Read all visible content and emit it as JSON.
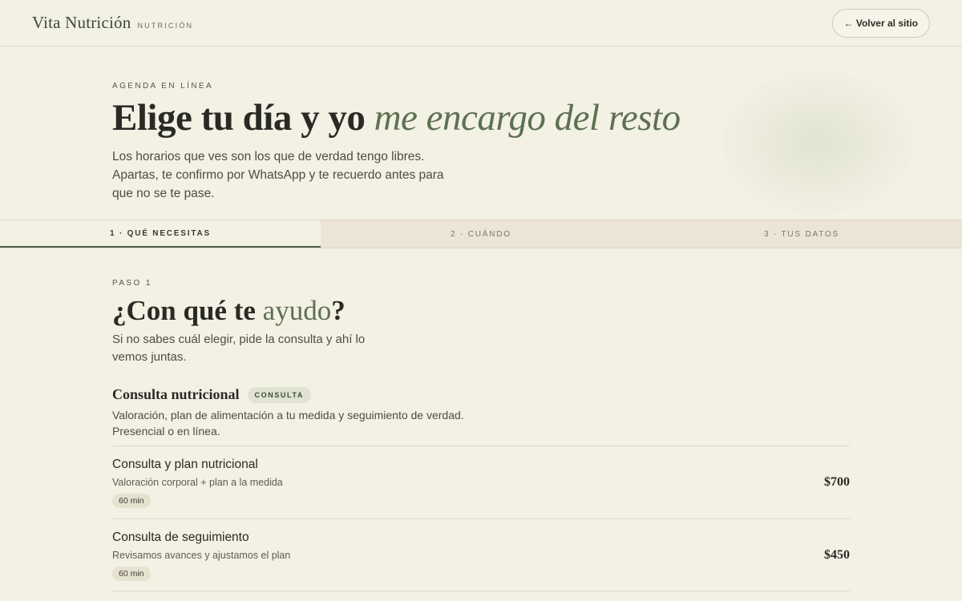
{
  "header": {
    "brand_name": "Vita Nutrición",
    "brand_tag": "NUTRICIÓN",
    "back_label": "← Volver al sitio"
  },
  "hero": {
    "eyebrow": "AGENDA EN LÍNEA",
    "title_main": "Elige tu día y yo",
    "title_accent": "me encargo del resto",
    "description": "Los horarios que ves son los que de verdad tengo libres. Apartas, te confirmo por WhatsApp y te recuerdo antes para que no se te pase."
  },
  "steps": [
    {
      "label": "1 · QUÉ NECESITAS",
      "active": true
    },
    {
      "label": "2 · CUÁNDO",
      "active": false
    },
    {
      "label": "3 · TUS DATOS",
      "active": false
    }
  ],
  "step1": {
    "eyebrow": "PASO 1",
    "title_pre": "¿Con qué te",
    "title_accent": "ayudo",
    "title_post": "?",
    "description": "Si no sabes cuál elegir, pide la consulta y ahí lo vemos juntas.",
    "category": {
      "name": "Consulta nutricional",
      "badge": "CONSULTA",
      "description": "Valoración, plan de alimentación a tu medida y seguimiento de verdad. Presencial o en línea."
    },
    "services": [
      {
        "name": "Consulta y plan nutricional",
        "subtitle": "Valoración corporal + plan a la medida",
        "duration": "60 min",
        "price": "$700"
      },
      {
        "name": "Consulta de seguimiento",
        "subtitle": "Revisamos avances y ajustamos el plan",
        "duration": "60 min",
        "price": "$450"
      }
    ]
  },
  "colors": {
    "background": "#f3f0e4",
    "accent_green": "#5d7150",
    "step_inactive_bg": "#ece5d6",
    "badge_bg": "#e0e3d2"
  }
}
